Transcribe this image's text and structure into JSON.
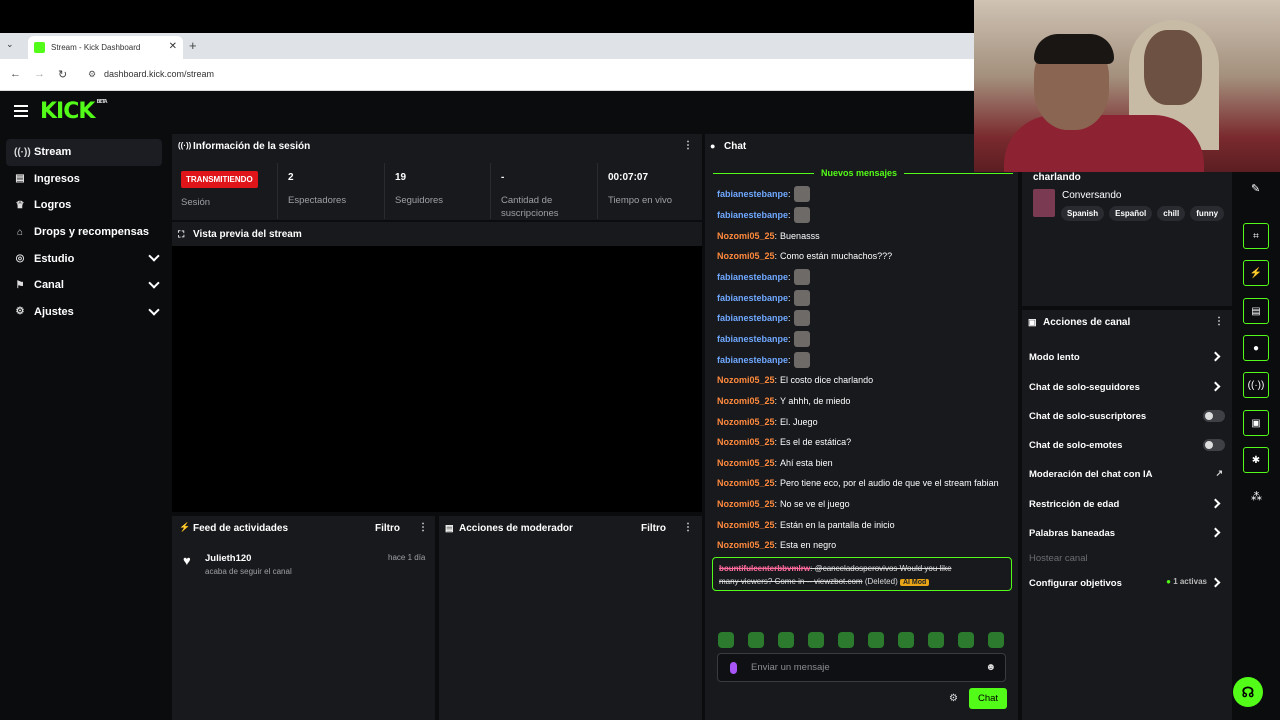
{
  "browser": {
    "tab_title": "Stream - Kick Dashboard",
    "url": "dashboard.kick.com/stream"
  },
  "app": {
    "logo": "KICK",
    "logo_badge": "BETA"
  },
  "sidebar": {
    "items": [
      {
        "label": "Stream",
        "icon": "stream-icon"
      },
      {
        "label": "Ingresos",
        "icon": "wallet-icon"
      },
      {
        "label": "Logros",
        "icon": "trophy-icon"
      },
      {
        "label": "Drops y recompensas",
        "icon": "gift-icon"
      },
      {
        "label": "Estudio",
        "icon": "studio-icon"
      },
      {
        "label": "Canal",
        "icon": "channel-icon"
      },
      {
        "label": "Ajustes",
        "icon": "gear-icon"
      }
    ]
  },
  "session": {
    "title": "Información de la sesión",
    "status": "TRANSMITIENDO",
    "status_label": "Sesión",
    "viewers": "2",
    "viewers_label": "Espectadores",
    "followers": "19",
    "followers_label": "Seguidores",
    "subs": "-",
    "subs_label": "Cantidad de suscripciones",
    "uptime": "00:07:07",
    "uptime_label": "Tiempo en vivo"
  },
  "preview": {
    "title": "Vista previa del stream"
  },
  "feed": {
    "title": "Feed de actividades",
    "filter": "Filtro",
    "items": [
      {
        "user": "Julieth120",
        "action": "acaba de seguir el canal",
        "time": "hace 1 día"
      }
    ]
  },
  "modactions": {
    "title": "Acciones de moderador",
    "filter": "Filtro"
  },
  "chat": {
    "title": "Chat",
    "new_messages": "Nuevos mensajes",
    "messages": [
      {
        "user": "fabianestebanpe",
        "text": "",
        "emote": true,
        "color": "#6fa8ff"
      },
      {
        "user": "fabianestebanpe",
        "text": "",
        "emote": true,
        "color": "#6fa8ff"
      },
      {
        "user": "Nozomi05_25",
        "text": "Buenasss",
        "emote": false,
        "color": "#ff8a3d"
      },
      {
        "user": "Nozomi05_25",
        "text": "Como están muchachos???",
        "emote": false,
        "color": "#ff8a3d"
      },
      {
        "user": "fabianestebanpe",
        "text": "",
        "emote": true,
        "color": "#6fa8ff"
      },
      {
        "user": "fabianestebanpe",
        "text": "",
        "emote": true,
        "color": "#6fa8ff"
      },
      {
        "user": "fabianestebanpe",
        "text": "",
        "emote": true,
        "color": "#6fa8ff"
      },
      {
        "user": "fabianestebanpe",
        "text": "",
        "emote": true,
        "color": "#6fa8ff"
      },
      {
        "user": "fabianestebanpe",
        "text": "",
        "emote": true,
        "color": "#6fa8ff"
      },
      {
        "user": "Nozomi05_25",
        "text": "El costo dice charlando",
        "emote": false,
        "color": "#ff8a3d"
      },
      {
        "user": "Nozomi05_25",
        "text": "Y ahhh, de miedo",
        "emote": false,
        "color": "#ff8a3d"
      },
      {
        "user": "Nozomi05_25",
        "text": "El. Juego",
        "emote": false,
        "color": "#ff8a3d"
      },
      {
        "user": "Nozomi05_25",
        "text": "Es el de estática?",
        "emote": false,
        "color": "#ff8a3d"
      },
      {
        "user": "Nozomi05_25",
        "text": "Ahí esta bien",
        "emote": false,
        "color": "#ff8a3d"
      },
      {
        "user": "Nozomi05_25",
        "text": "Pero tiene eco, por el audio de que ve el stream fabian",
        "emote": false,
        "color": "#ff8a3d"
      },
      {
        "user": "Nozomi05_25",
        "text": "No se ve el juego",
        "emote": false,
        "color": "#ff8a3d"
      },
      {
        "user": "Nozomi05_25",
        "text": "Están en la pantalla de inicio",
        "emote": false,
        "color": "#ff8a3d"
      },
      {
        "user": "Nozomi05_25",
        "text": "Esta en negro",
        "emote": false,
        "color": "#ff8a3d"
      }
    ],
    "deleted": {
      "user": "bountifulcenterbbvmlrw",
      "text1": "@canceladosperovivos Would you like",
      "text2": "many viewers? Come in -- viewzbot.com",
      "tag": "(Deleted)",
      "badge": "AI Mod"
    },
    "input_placeholder": "Enviar un mensaje",
    "send_label": "Chat"
  },
  "stream_info": {
    "title": "charlando",
    "category": "Conversando",
    "tags": [
      "Spanish",
      "Español",
      "chill",
      "funny"
    ]
  },
  "channel_actions": {
    "title": "Acciones de canal",
    "items": [
      {
        "label": "Modo lento",
        "kind": "arrow"
      },
      {
        "label": "Chat de solo-seguidores",
        "kind": "arrow"
      },
      {
        "label": "Chat de solo-suscriptores",
        "kind": "toggle"
      },
      {
        "label": "Chat de solo-emotes",
        "kind": "toggle"
      },
      {
        "label": "Moderación del chat con IA",
        "kind": "external"
      },
      {
        "label": "Restricción de edad",
        "kind": "arrow"
      },
      {
        "label": "Palabras baneadas",
        "kind": "arrow"
      },
      {
        "label": "Hostear canal",
        "kind": "disabled"
      },
      {
        "label": "Configurar objetivos",
        "kind": "arrow"
      }
    ],
    "goals_active": "1 activas"
  },
  "colors": {
    "accent": "#53fc18",
    "live": "#e0151a",
    "user_blue": "#6fa8ff",
    "user_orange": "#ff8a3d"
  }
}
